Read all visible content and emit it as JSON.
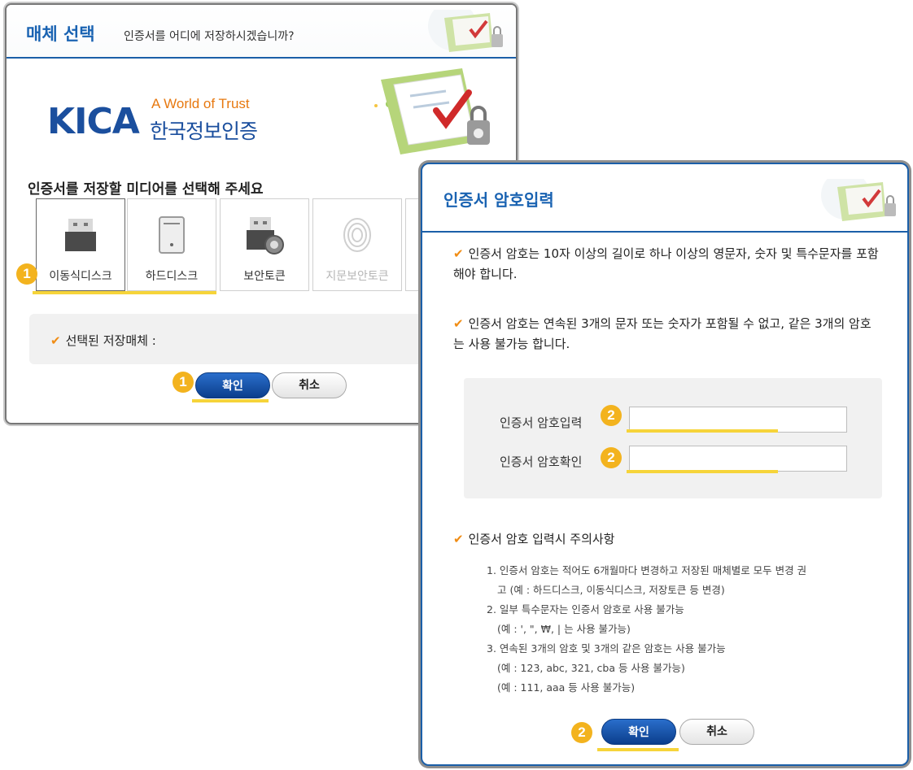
{
  "dialog1": {
    "title": "매체 선택",
    "subtitle": "인증서를 어디에 저장하시겠습니까?",
    "logo": {
      "brand": "KICA",
      "tagline": "A World of Trust",
      "korean": "한국정보인증"
    },
    "media_heading": "인증서를 저장할 미디어를 선택해 주세요",
    "media": [
      {
        "label": "이동식디스크",
        "icon": "usb-drive-icon",
        "enabled": true,
        "selected": true
      },
      {
        "label": "하드디스크",
        "icon": "hard-disk-icon",
        "enabled": true,
        "selected": false
      },
      {
        "label": "보안토큰",
        "icon": "security-token-icon",
        "enabled": true,
        "selected": false
      },
      {
        "label": "지문보안토큰",
        "icon": "fingerprint-icon",
        "enabled": false,
        "selected": false
      }
    ],
    "selected_label": "선택된 저장매체 :",
    "confirm": "확인",
    "cancel": "취소",
    "step_badge": "1"
  },
  "dialog2": {
    "title": "인증서 암호입력",
    "rule1": "인증서 암호는 10자 이상의 길이로 하나 이상의 영문자, 숫자 및 특수문자를 포함해야 합니다.",
    "rule2": "인증서 암호는 연속된 3개의 문자 또는 숫자가 포함될 수 없고, 같은 3개의 암호는 사용 불가능 합니다.",
    "password_label": "인증서 암호입력",
    "confirm_label": "인증서 암호확인",
    "password_value": "",
    "confirm_value": "",
    "caution_title": "인증서 암호 입력시 주의사항",
    "notes": [
      "1. 인증서 암호는 적어도 6개월마다 변경하고 저장된 매체별로 모두 변경 권",
      "고 (예 : 하드디스크, 이동식디스크, 저장토큰 등 변경)",
      "2. 일부 특수문자는 인증서 암호로 사용 불가능",
      "(예 : ', \", ₩, | 는 사용 불가능)",
      "3. 연속된 3개의 암호 및 3개의 같은 암호는 사용 불가능",
      "(예 : 123, abc, 321, cba 등 사용 불가능)",
      "(예 : 111, aaa 등 사용 불가능)"
    ],
    "confirm": "확인",
    "cancel": "취소",
    "step_badge": "2"
  },
  "colors": {
    "brand_blue": "#1a63b2",
    "accent_orange": "#f08c14",
    "badge_yellow": "#f3b31e",
    "highlight": "#f6d43a"
  }
}
